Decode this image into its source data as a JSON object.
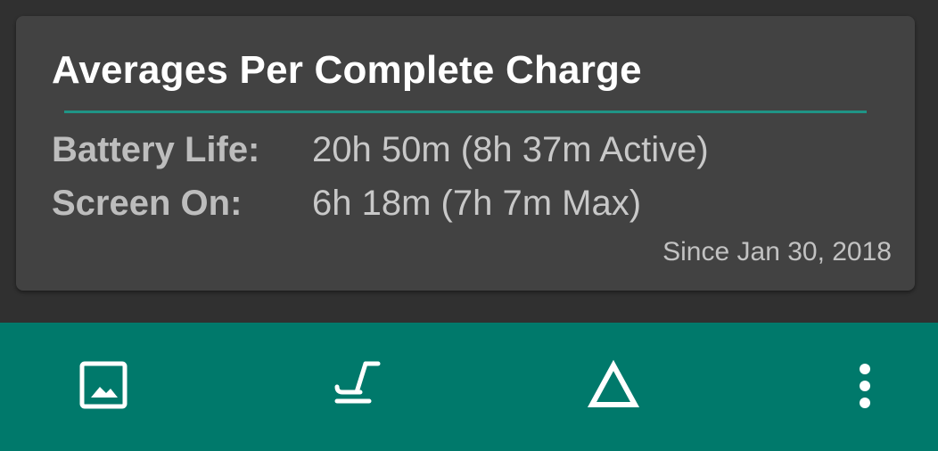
{
  "card": {
    "title": "Averages Per Complete Charge",
    "rows": [
      {
        "label": "Battery Life:",
        "value": "20h 50m (8h 37m Active)"
      },
      {
        "label": "Screen On:",
        "value": "6h 18m (7h 7m Max)"
      }
    ],
    "since": "Since Jan 30, 2018"
  },
  "bottom_bar": {
    "actions": [
      {
        "icon": "image-icon"
      },
      {
        "icon": "seat-icon"
      },
      {
        "icon": "delta-icon"
      },
      {
        "icon": "more-vert-icon"
      }
    ]
  },
  "colors": {
    "background": "#303030",
    "card": "#424242",
    "accent": "#1f9486",
    "bottom_bar": "#00796b"
  }
}
